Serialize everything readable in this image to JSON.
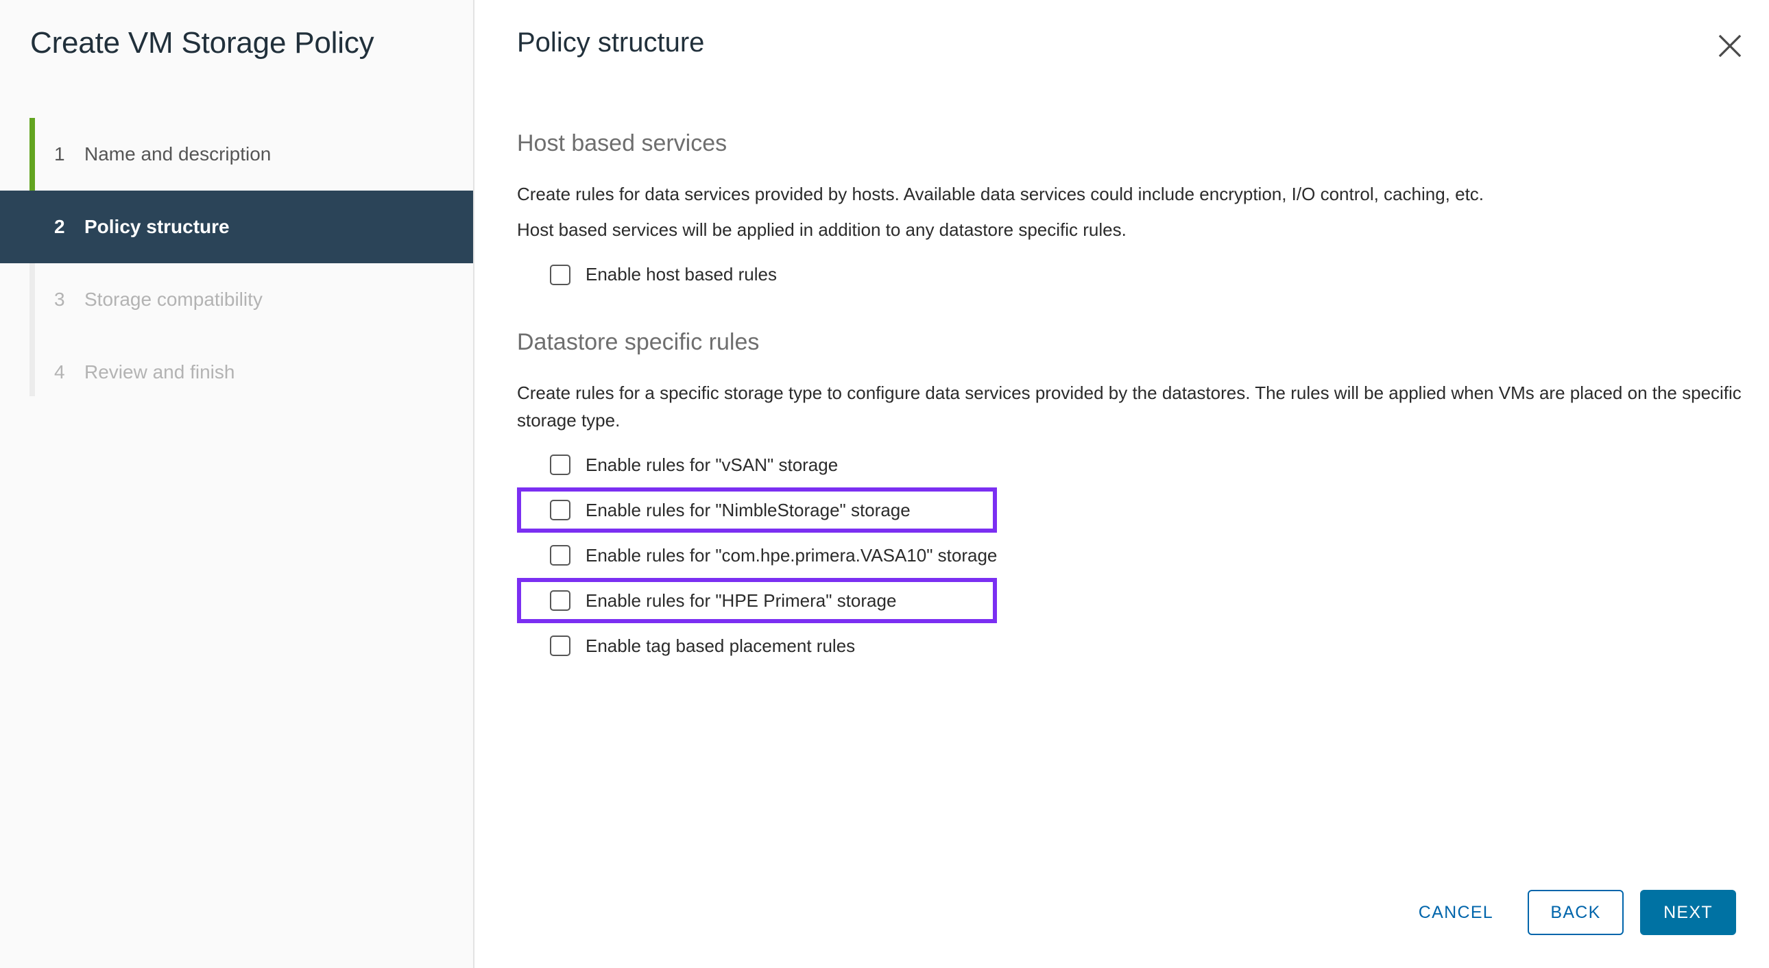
{
  "wizard": {
    "title": "Create VM Storage Policy",
    "steps": [
      {
        "number": "1",
        "label": "Name and description",
        "state": "done"
      },
      {
        "number": "2",
        "label": "Policy structure",
        "state": "active"
      },
      {
        "number": "3",
        "label": "Storage compatibility",
        "state": "upcoming"
      },
      {
        "number": "4",
        "label": "Review and finish",
        "state": "upcoming"
      }
    ]
  },
  "panel": {
    "title": "Policy structure",
    "close_icon": "close-icon"
  },
  "host_based_services": {
    "heading": "Host based services",
    "paragraph_1": "Create rules for data services provided by hosts. Available data services could include encryption, I/O control, caching, etc.",
    "paragraph_2": "Host based services will be applied in addition to any datastore specific rules.",
    "checkbox": {
      "label": "Enable host based rules",
      "checked": false
    }
  },
  "datastore_specific_rules": {
    "heading": "Datastore specific rules",
    "paragraph": "Create rules for a specific storage type to configure data services provided by the datastores. The rules will be applied when VMs are placed on the specific storage type.",
    "checkboxes": [
      {
        "label": "Enable rules for \"vSAN\" storage",
        "checked": false,
        "highlighted": false
      },
      {
        "label": "Enable rules for \"NimbleStorage\" storage",
        "checked": false,
        "highlighted": true
      },
      {
        "label": "Enable rules for \"com.hpe.primera.VASA10\" storage",
        "checked": false,
        "highlighted": false
      },
      {
        "label": "Enable rules for \"HPE Primera\" storage",
        "checked": false,
        "highlighted": true
      },
      {
        "label": "Enable tag based placement rules",
        "checked": false,
        "highlighted": false
      }
    ]
  },
  "footer": {
    "cancel_label": "CANCEL",
    "back_label": "BACK",
    "next_label": "NEXT"
  },
  "colors": {
    "accent_green": "#62a420",
    "active_step_bg": "#2b4458",
    "primary_blue": "#0072a3",
    "link_blue": "#0065ab",
    "highlight_purple": "#7b2ff2",
    "sidebar_bg": "#fafafa"
  }
}
